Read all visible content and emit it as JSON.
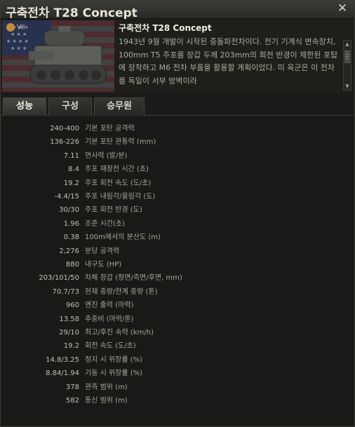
{
  "window": {
    "title": "구축전차 T28 Concept"
  },
  "vehicle": {
    "tier": "VII",
    "name": "구축전차 T28 Concept",
    "description": "1943년 9월 개발이 시작된 중돌파전차이다. 전기 기계식 변속장치, 100mm T5 주포를 장갑 두께 203mm의 회전 반경이 제한된 포탑에 장착하고 M6 전차 부품을 활용할 계획이었다. 미 육군은 이 전차를 독일이 서부 방벽이라"
  },
  "tabs": [
    {
      "label": "성능",
      "active": true
    },
    {
      "label": "구성",
      "active": false
    },
    {
      "label": "승무원",
      "active": false
    }
  ],
  "stats": [
    {
      "value": "240-400",
      "label": "기본 포탄 공격력"
    },
    {
      "value": "136-226",
      "label": "기본 포탄 관통력 (mm)"
    },
    {
      "value": "7.11",
      "label": "연사력 (발/분)"
    },
    {
      "value": "8.4",
      "label": "주포 재장전 시간 (초)"
    },
    {
      "value": "19.2",
      "label": "주포 회전 속도 (도/초)"
    },
    {
      "value": "-4.4/15",
      "label": "주포 내림각/올림각 (도)"
    },
    {
      "value": "30/30",
      "label": "주포 회전 반경 (도)"
    },
    {
      "value": "1.96",
      "label": "조준 시간(초)"
    },
    {
      "value": "0.38",
      "label": "100m에서의 분산도 (m)"
    },
    {
      "value": "2,276",
      "label": "분당 공격력"
    },
    {
      "value": "880",
      "label": "내구도 (HP)"
    },
    {
      "value": "203/101/50",
      "label": "차체 장갑 (정면/측면/후면, mm)"
    },
    {
      "value": "70.7/73",
      "label": "현재 중량/한계 중량 (톤)"
    },
    {
      "value": "960",
      "label": "엔진 출력 (마력)"
    },
    {
      "value": "13.58",
      "label": "추중비 (마력/톤)"
    },
    {
      "value": "29/10",
      "label": "최고/후진 속력 (km/h)"
    },
    {
      "value": "19.2",
      "label": "회전 속도 (도/초)"
    },
    {
      "value": "14.8/3.25",
      "label": "정지 시 위장률 (%)"
    },
    {
      "value": "8.84/1.94",
      "label": "기동 시 위장률 (%)"
    },
    {
      "value": "378",
      "label": "관측 범위 (m)"
    },
    {
      "value": "582",
      "label": "통신 범위 (m)"
    }
  ]
}
